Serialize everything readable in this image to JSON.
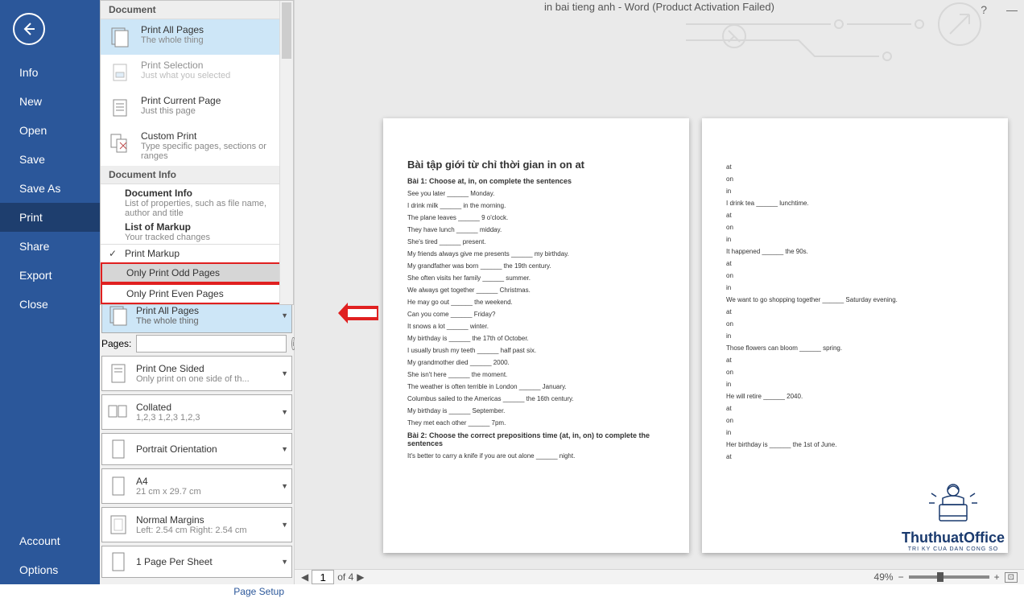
{
  "window_title": "in bai tieng anh - Word (Product Activation Failed)",
  "nav": {
    "info": "Info",
    "new": "New",
    "open": "Open",
    "save": "Save",
    "saveas": "Save As",
    "print": "Print",
    "share": "Share",
    "export": "Export",
    "close": "Close",
    "account": "Account",
    "options": "Options"
  },
  "dropdown": {
    "head1": "Document",
    "all": {
      "t": "Print All Pages",
      "s": "The whole thing"
    },
    "selection": {
      "t": "Print Selection",
      "s": "Just what you selected"
    },
    "current": {
      "t": "Print Current Page",
      "s": "Just this page"
    },
    "custom": {
      "t": "Custom Print",
      "s": "Type specific pages, sections or ranges"
    },
    "head2": "Document Info",
    "info": {
      "t": "Document Info",
      "s": "List of properties, such as file name, author and title"
    },
    "markup": {
      "t": "List of Markup",
      "s": "Your tracked changes"
    },
    "printmarkup": "Print Markup",
    "odd": "Only Print Odd Pages",
    "even": "Only Print Even Pages"
  },
  "selected": {
    "t": "Print All Pages",
    "s": "The whole thing"
  },
  "pages_label": "Pages:",
  "settings": {
    "oneside": {
      "t": "Print One Sided",
      "s": "Only print on one side of th..."
    },
    "collated": {
      "t": "Collated",
      "s": "1,2,3    1,2,3    1,2,3"
    },
    "portrait": {
      "t": "Portrait Orientation",
      "s": ""
    },
    "a4": {
      "t": "A4",
      "s": "21 cm x 29.7 cm"
    },
    "margins": {
      "t": "Normal Margins",
      "s": "Left:  2.54 cm   Right:  2.54 cm"
    },
    "perpage": {
      "t": "1 Page Per Sheet",
      "s": ""
    }
  },
  "page_setup": "Page Setup",
  "footer": {
    "of": "of 4",
    "page": "1",
    "zoom": "49%"
  },
  "doc": {
    "title": "Bài tập giới từ chỉ thời gian in on at",
    "bai1": "Bài 1: Choose at, in, on complete the sentences",
    "lines1": [
      "See you later ______ Monday.",
      "I drink milk ______ in the morning.",
      "The plane leaves ______ 9 o'clock.",
      "They have lunch ______ midday.",
      "She's tired ______ present.",
      "My friends always give me presents ______ my birthday.",
      "My grandfather was born ______ the 19th century.",
      "She often visits her family ______ summer.",
      "We always get together ______ Christmas.",
      "He may go out ______ the weekend.",
      "Can you come ______ Friday?",
      "It snows a lot ______ winter.",
      "My birthday is ______ the 17th of October.",
      "I usually brush my teeth ______ half past six.",
      "My grandmother died ______ 2000.",
      "She isn't here ______ the moment.",
      "The weather is often terrible in London ______ January.",
      "Columbus sailed to the Americas ______ the 16th century.",
      "My birthday is ______ September.",
      "They met each other ______ 7pm."
    ],
    "bai2": "Bài 2: Choose the correct prepositions time (at, in, on) to complete the sentences",
    "line2": "It's better to carry a knife if you are out alone ______ night.",
    "lines_p2": [
      "at",
      "on",
      "in",
      "I drink tea ______ lunchtime.",
      "at",
      "on",
      "in",
      "It happened ______ the 90s.",
      "at",
      "on",
      "in",
      "We want to go shopping together ______ Saturday evening.",
      "at",
      "on",
      "in",
      "Those flowers can bloom ______ spring.",
      "at",
      "on",
      "in",
      "He will retire ______ 2040.",
      "at",
      "on",
      "in",
      "Her birthday is ______ the 1st of June.",
      "at"
    ]
  },
  "logo": {
    "brand": "ThuthuatOffice",
    "sub": "TRI KY CUA DAN CONG SO"
  }
}
